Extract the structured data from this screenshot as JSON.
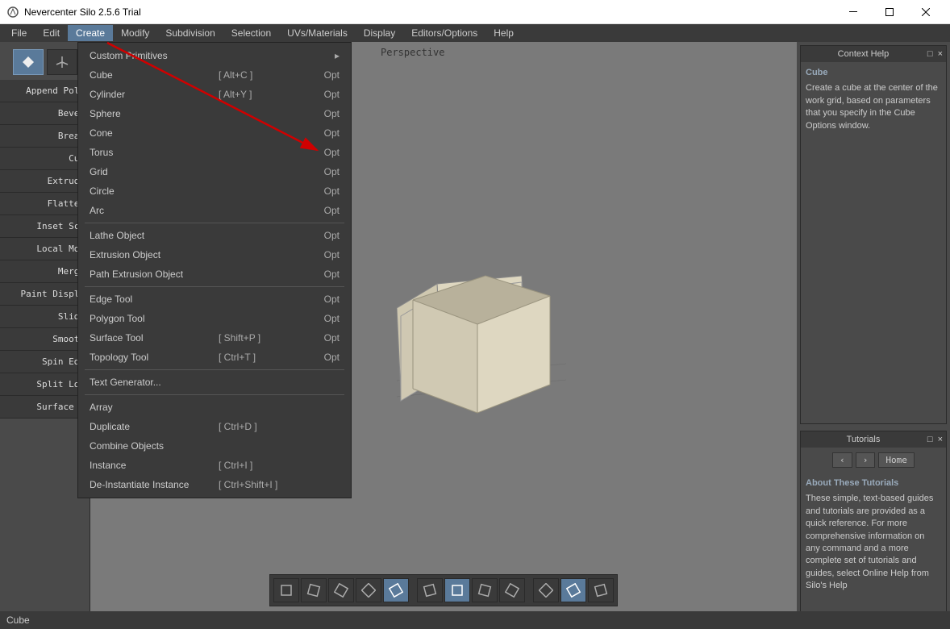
{
  "window": {
    "title": "Nevercenter Silo 2.5.6 Trial"
  },
  "menubar": [
    "File",
    "Edit",
    "Create",
    "Modify",
    "Subdivision",
    "Selection",
    "UVs/Materials",
    "Display",
    "Editors/Options",
    "Help"
  ],
  "menubar_active_index": 2,
  "left_tools": [
    "Append Poly",
    "Bevel",
    "Break",
    "Cut",
    "Extrude",
    "Flatten",
    "Inset Sca",
    "Local Mov",
    "Merge",
    "Paint Displa",
    "Slide",
    "Smooth",
    "Spin Edg",
    "Split Loo",
    "Surface T"
  ],
  "viewport": {
    "label": "Perspective"
  },
  "dropdown": [
    {
      "label": "Custom Primitives",
      "shortcut": "",
      "opt": "",
      "submenu": true
    },
    {
      "label": "Cube",
      "shortcut": "[ Alt+C ]",
      "opt": "Opt"
    },
    {
      "label": "Cylinder",
      "shortcut": "[ Alt+Y ]",
      "opt": "Opt"
    },
    {
      "label": "Sphere",
      "shortcut": "",
      "opt": "Opt"
    },
    {
      "label": "Cone",
      "shortcut": "",
      "opt": "Opt"
    },
    {
      "label": "Torus",
      "shortcut": "",
      "opt": "Opt"
    },
    {
      "label": "Grid",
      "shortcut": "",
      "opt": "Opt"
    },
    {
      "label": "Circle",
      "shortcut": "",
      "opt": "Opt"
    },
    {
      "label": "Arc",
      "shortcut": "",
      "opt": "Opt"
    },
    {
      "sep": true
    },
    {
      "label": "Lathe Object",
      "shortcut": "",
      "opt": "Opt"
    },
    {
      "label": "Extrusion Object",
      "shortcut": "",
      "opt": "Opt"
    },
    {
      "label": "Path Extrusion Object",
      "shortcut": "",
      "opt": "Opt"
    },
    {
      "sep": true
    },
    {
      "label": "Edge Tool",
      "shortcut": "",
      "opt": "Opt"
    },
    {
      "label": "Polygon Tool",
      "shortcut": "",
      "opt": "Opt"
    },
    {
      "label": "Surface Tool",
      "shortcut": "[ Shift+P ]",
      "opt": "Opt"
    },
    {
      "label": "Topology Tool",
      "shortcut": "[ Ctrl+T ]",
      "opt": "Opt"
    },
    {
      "sep": true
    },
    {
      "label": "Text Generator...",
      "shortcut": "",
      "opt": ""
    },
    {
      "sep": true
    },
    {
      "label": "Array",
      "shortcut": "",
      "opt": ""
    },
    {
      "label": "Duplicate",
      "shortcut": "[ Ctrl+D ]",
      "opt": ""
    },
    {
      "label": "Combine Objects",
      "shortcut": "",
      "opt": ""
    },
    {
      "label": "Instance",
      "shortcut": "[ Ctrl+I ]",
      "opt": ""
    },
    {
      "label": "De-Instantiate Instance",
      "shortcut": "[ Ctrl+Shift+I ]",
      "opt": ""
    }
  ],
  "context_help": {
    "title": "Context Help",
    "heading": "Cube",
    "body": "Create a cube at the center of the work grid, based on parameters that you specify in the Cube Options window."
  },
  "tutorials": {
    "title": "Tutorials",
    "home": "Home",
    "heading": "About These Tutorials",
    "body": "These simple, text-based guides and tutorials are provided as a quick reference. For more comprehensive information on any command and a more complete set of tutorials and guides, select Online Help from Silo's Help"
  },
  "statusbar": {
    "text": "Cube"
  },
  "bottom_icons": [
    "shape1",
    "shape2",
    "shape3",
    "shape4",
    "cube",
    "axis1",
    "axis2",
    "axis3",
    "axis4",
    "curve1",
    "select",
    "curve2"
  ],
  "bottom_selected": [
    4,
    6,
    10
  ]
}
